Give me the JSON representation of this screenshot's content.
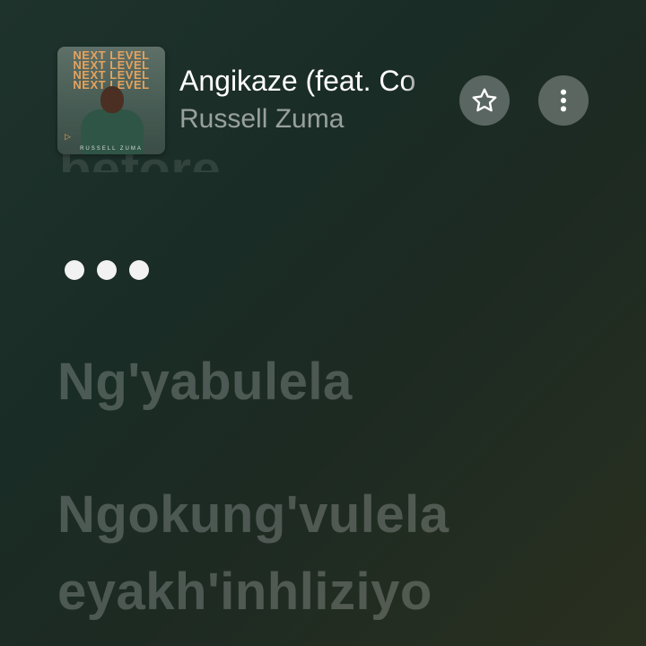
{
  "now_playing": {
    "song_title": "Angikaze (feat. Co",
    "artist": "Russell Zuma",
    "artwork": {
      "title_text": "NEXT LEVEL\nNEXT LEVEL\nNEXT LEVEL\nNEXT LEVEL",
      "artist_text": "RUSSELL ZUMA"
    }
  },
  "controls": {
    "favorite_icon": "star-icon",
    "more_icon": "more-vertical-icon"
  },
  "lyrics": {
    "previous_line": "before",
    "lines": [
      "Ng'yabulela",
      "Ngokung'vulela",
      "eyakh'inhliziyo"
    ]
  }
}
